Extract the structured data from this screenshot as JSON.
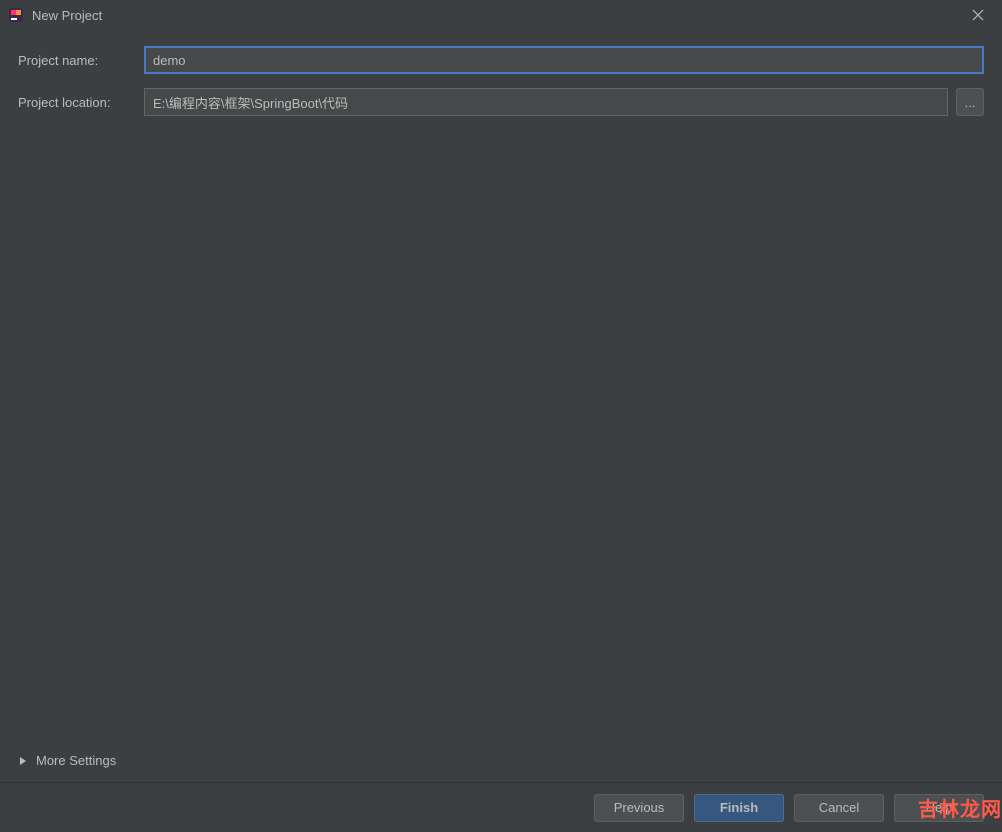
{
  "window": {
    "title": "New Project"
  },
  "form": {
    "projectNameLabel": "Project name:",
    "projectNameValue": "demo",
    "projectLocationLabel": "Project location:",
    "projectLocationValue": "E:\\编程内容\\框架\\SpringBoot\\代码",
    "browseLabel": "..."
  },
  "moreSettings": {
    "label": "More Settings"
  },
  "footer": {
    "previous": "Previous",
    "finish": "Finish",
    "cancel": "Cancel",
    "help": "Help"
  },
  "watermark": "吉林龙网"
}
